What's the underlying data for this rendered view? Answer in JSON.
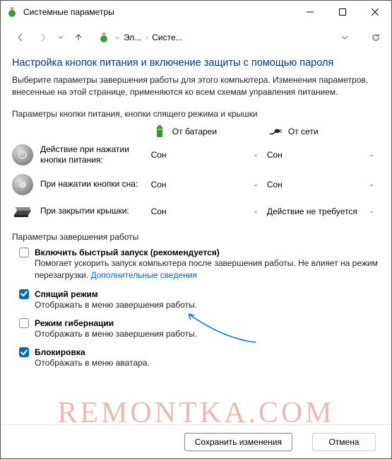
{
  "titlebar": {
    "title": "Системные параметры"
  },
  "nav": {
    "crumb1": "Эл...",
    "crumb2": "Систе..."
  },
  "header": {
    "title": "Настройка кнопок питания и включение защиты с помощью пароля",
    "desc": "Выберите параметры завершения работы для этого компьютера. Изменения параметров, внесенные на этой странице, применяются ко всем схемам управления питанием."
  },
  "buttons_section": {
    "heading": "Параметры кнопки питания, кнопки спящего режима и крышки",
    "col_battery": "От батареи",
    "col_ac": "От сети",
    "rows": [
      {
        "label": "Действие при нажатии кнопки питания:",
        "battery": "Сон",
        "ac": "Сон"
      },
      {
        "label": "При нажатии кнопки сна:",
        "battery": "Сон",
        "ac": "Сон"
      },
      {
        "label": "При закрытии крышки:",
        "battery": "Сон",
        "ac": "Действие не требуется"
      }
    ]
  },
  "shutdown": {
    "heading": "Параметры завершения работы",
    "items": [
      {
        "checked": false,
        "title": "Включить быстрый запуск (рекомендуется)",
        "desc_pre": "Помогает ускорить запуск компьютера после завершения работы. Не влияет на режим перезагрузки. ",
        "link": "Дополнительные сведения"
      },
      {
        "checked": true,
        "title": "Спящий режим",
        "desc_pre": "Отображать в меню завершения работы."
      },
      {
        "checked": false,
        "title": "Режим гибернации",
        "desc_pre": "Отображать в меню завершения работы."
      },
      {
        "checked": true,
        "title": "Блокировка",
        "desc_pre": "Отображать в меню аватара."
      }
    ]
  },
  "footer": {
    "save": "Сохранить изменения",
    "cancel": "Отмена"
  },
  "watermark": "REMONTKA.COM"
}
